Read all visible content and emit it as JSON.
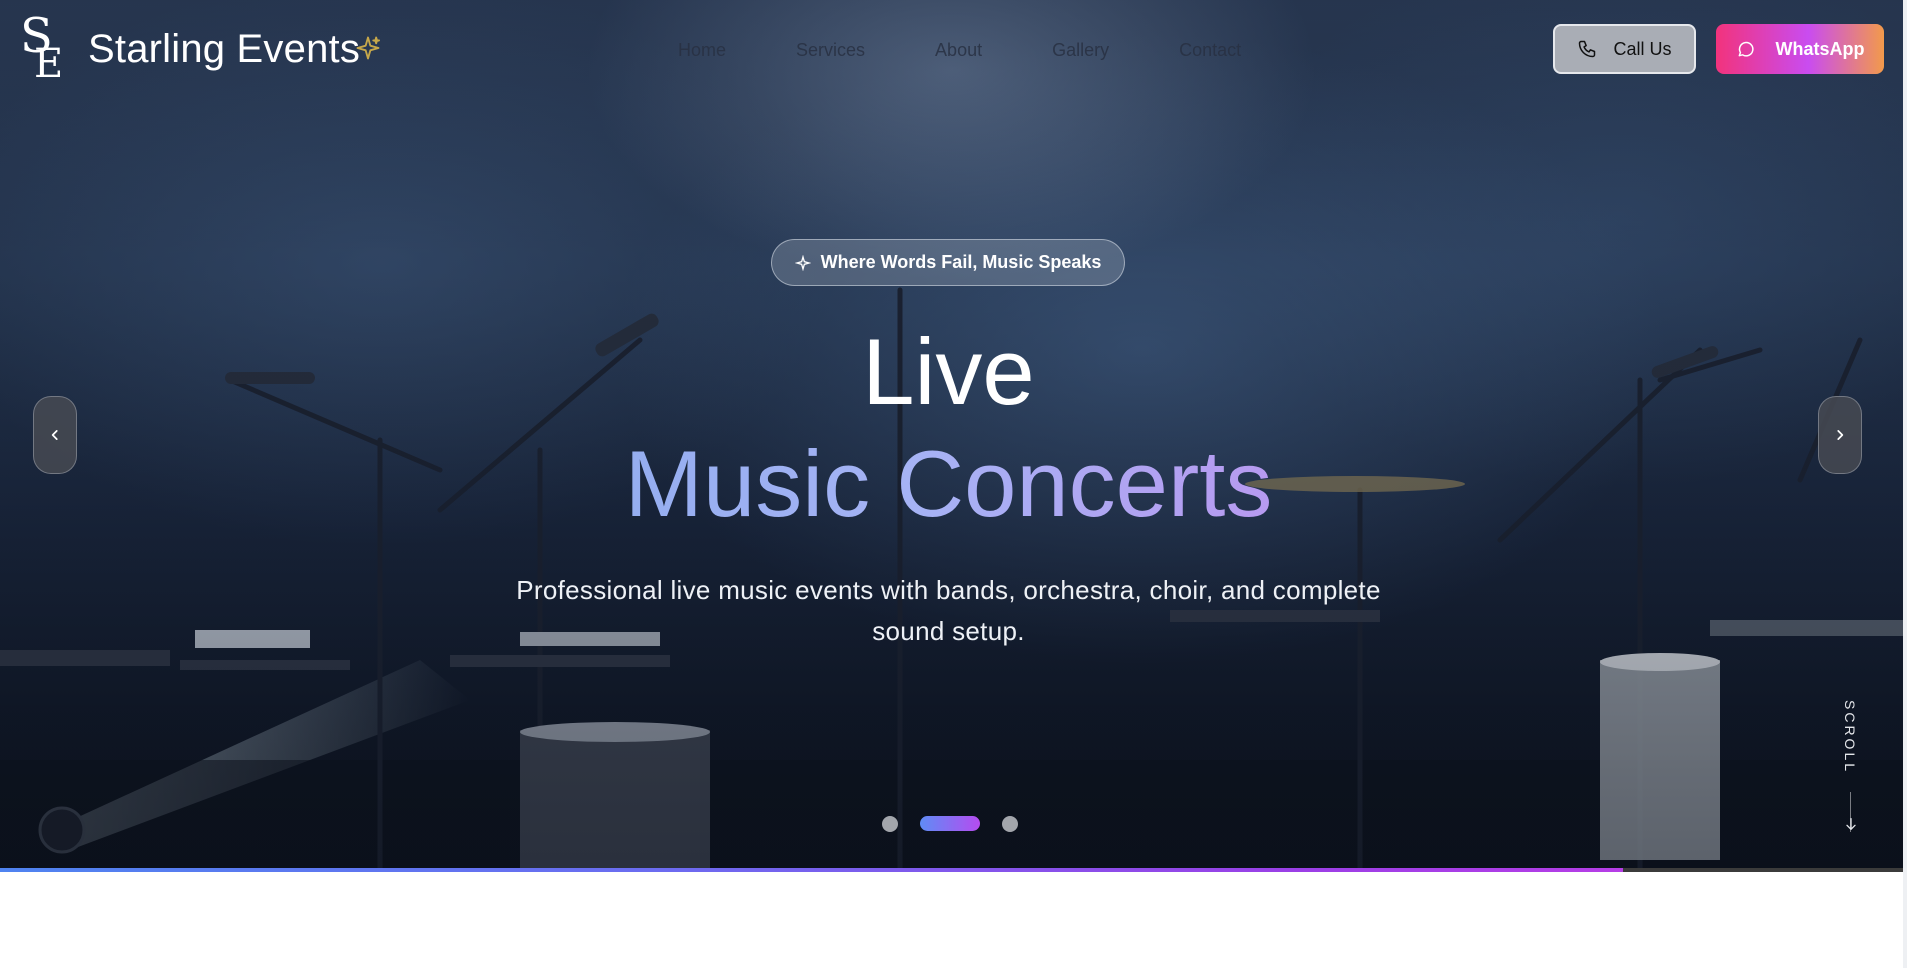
{
  "brand": {
    "logo_letters": "SE",
    "name": "Starling Events",
    "accent_color": "#c7a84a"
  },
  "nav": {
    "items": [
      {
        "label": "Home"
      },
      {
        "label": "Services"
      },
      {
        "label": "About"
      },
      {
        "label": "Gallery"
      },
      {
        "label": "Contact"
      }
    ]
  },
  "actions": {
    "call_label": "Call Us",
    "call_icon": "phone-icon",
    "whatsapp_label": "WhatsApp",
    "whatsapp_icon": "chat-bubble-icon",
    "whatsapp_gradient": [
      "#f2337c",
      "#c94cf0",
      "#f29a4b"
    ]
  },
  "hero": {
    "tagline": "Where Words Fail, Music Speaks",
    "tagline_icon": "music-note-icon",
    "title_line1": "Live",
    "title_line2": "Music Concerts",
    "subtitle": "Professional live music events with bands, orchestra, choir, and complete sound setup.",
    "prev_icon": "chevron-left-icon",
    "next_icon": "chevron-right-icon",
    "slides": {
      "count": 3,
      "active_index": 1
    },
    "scroll_label": "SCROLL",
    "progress_fraction": 0.853,
    "progress_colors": [
      "#4f83f0",
      "#b63ee6"
    ]
  }
}
